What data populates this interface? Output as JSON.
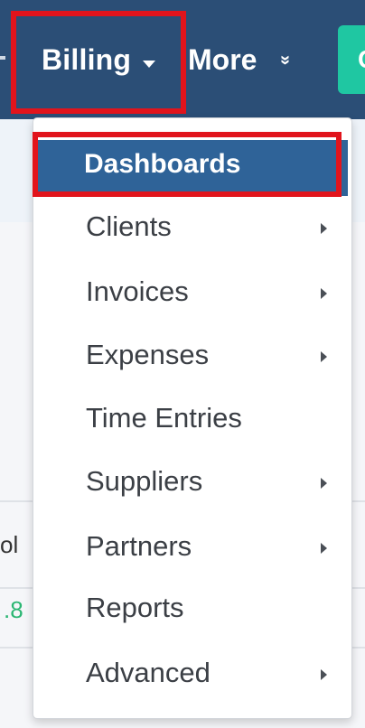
{
  "navbar": {
    "billing_label": "Billing",
    "more_label": "More",
    "more_icon": "double-chevron-down-icon",
    "more_glyph": "»",
    "teal_button_text": "C"
  },
  "background": {
    "row_text_1": "ol",
    "row_text_2": ".8"
  },
  "dropdown": {
    "items": [
      {
        "label": "Dashboards",
        "submenu": false,
        "active": true
      },
      {
        "label": "Clients",
        "submenu": true
      },
      {
        "label": "Invoices",
        "submenu": true
      },
      {
        "label": "Expenses",
        "submenu": true
      },
      {
        "label": "Time Entries",
        "submenu": false
      },
      {
        "label": "Suppliers",
        "submenu": true
      },
      {
        "label": "Partners",
        "submenu": true
      },
      {
        "label": "Reports",
        "submenu": false
      },
      {
        "label": "Advanced",
        "submenu": true
      }
    ]
  },
  "colors": {
    "navbar": "#2b4e76",
    "highlight": "#2f6398",
    "annotation_red": "#e1141c",
    "teal": "#1fc7a2"
  }
}
